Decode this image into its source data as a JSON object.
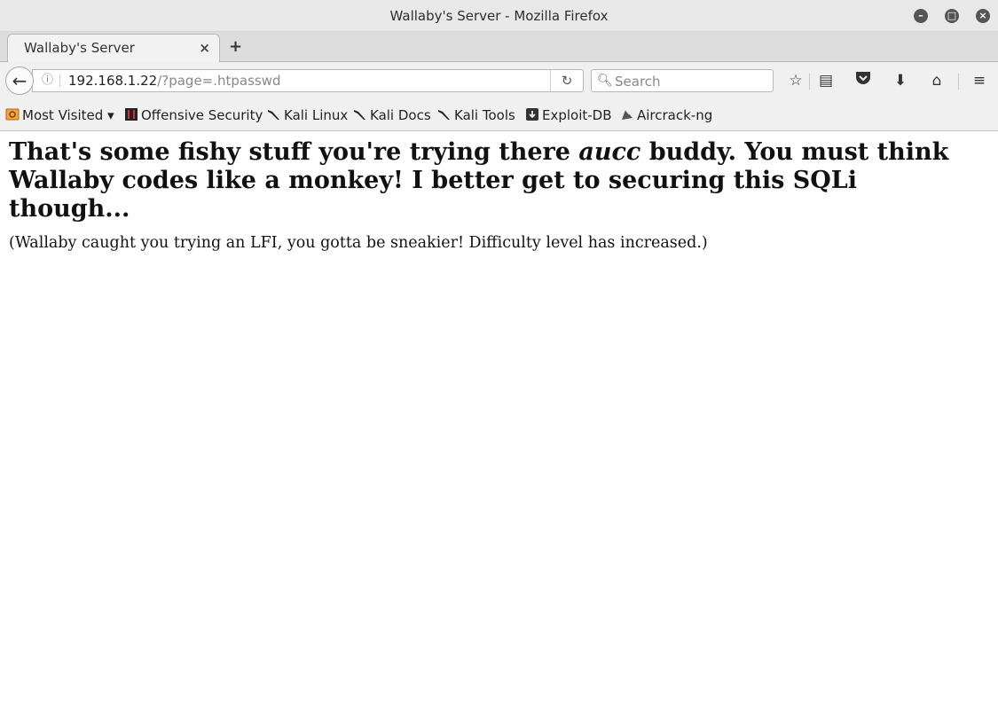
{
  "window": {
    "title": "Wallaby's Server - Mozilla Firefox"
  },
  "tabs": [
    {
      "label": "Wallaby's Server",
      "close": "×"
    }
  ],
  "new_tab_label": "+",
  "navbar": {
    "back_icon": "back-arrow-icon",
    "url_host": "192.168.1.22",
    "url_path": "/?page=.htpasswd",
    "search_placeholder": "Search",
    "icons": [
      "bookmark-star-icon",
      "reading-list-icon",
      "pocket-icon",
      "download-icon",
      "home-icon",
      "menu-icon"
    ]
  },
  "bookmarks": [
    {
      "label": "Most Visited ▾",
      "icon": "most-visited-icon"
    },
    {
      "label": "Offensive Security",
      "icon": "offsec-icon"
    },
    {
      "label": "Kali Linux",
      "icon": "kali-dragon-icon"
    },
    {
      "label": "Kali Docs",
      "icon": "kali-dragon-icon"
    },
    {
      "label": "Kali Tools",
      "icon": "kali-dragon-icon"
    },
    {
      "label": "Exploit-DB",
      "icon": "exploitdb-icon"
    },
    {
      "label": "Aircrack-ng",
      "icon": "aircrack-icon"
    }
  ],
  "page": {
    "headline_part1": "That's some fishy stuff you're trying there ",
    "headline_user": "aucc",
    "headline_part2": " buddy. You must think Wallaby codes like a monkey! I better get to securing this SQLi though...",
    "notice": "(Wallaby caught you trying an LFI, you gotta be sneakier! Difficulty level has increased.)"
  }
}
